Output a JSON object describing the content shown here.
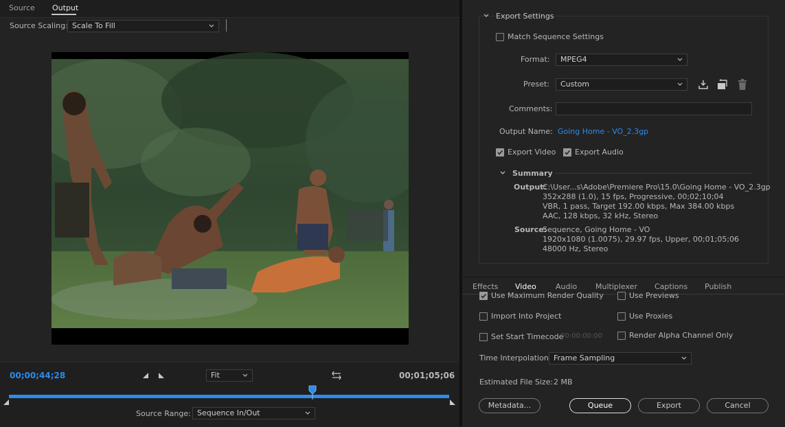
{
  "left": {
    "tabs": [
      {
        "label": "Source"
      },
      {
        "label": "Output"
      }
    ],
    "source_scaling": {
      "label": "Source Scaling:",
      "value": "Scale To Fill"
    },
    "timecode_current": "00;00;44;28",
    "timecode_end": "00;01;05;06",
    "zoom": {
      "value": "Fit"
    },
    "source_range": {
      "label": "Source Range:",
      "value": "Sequence In/Out"
    },
    "playhead_fraction": 0.69
  },
  "export_settings": {
    "header": "Export Settings",
    "match_sequence": {
      "label": "Match Sequence Settings",
      "checked": false
    },
    "format": {
      "label": "Format:",
      "value": "MPEG4"
    },
    "preset": {
      "label": "Preset:",
      "value": "Custom"
    },
    "comments": {
      "label": "Comments:",
      "value": ""
    },
    "output_name": {
      "label": "Output Name:",
      "value": "Going Home - VO_2.3gp"
    },
    "export_video": {
      "label": "Export Video",
      "checked": true
    },
    "export_audio": {
      "label": "Export Audio",
      "checked": true
    },
    "summary": {
      "header": "Summary",
      "output_label": "Output:",
      "output_lines": [
        "C:\\User...s\\Adobe\\Premiere Pro\\15.0\\Going Home - VO_2.3gp",
        "352x288 (1.0), 15 fps, Progressive, 00;02;10;04",
        "VBR, 1 pass, Target 192.00 kbps, Max 384.00 kbps",
        "AAC, 128 kbps, 32 kHz, Stereo"
      ],
      "source_label": "Source:",
      "source_lines": [
        "Sequence, Going Home - VO",
        "1920x1080 (1.0075), 29.97 fps, Upper, 00;01;05;06",
        "48000 Hz, Stereo"
      ]
    }
  },
  "settings_tabs": [
    {
      "label": "Effects"
    },
    {
      "label": "Video"
    },
    {
      "label": "Audio"
    },
    {
      "label": "Multiplexer"
    },
    {
      "label": "Captions"
    },
    {
      "label": "Publish"
    }
  ],
  "options": {
    "max_render_quality": {
      "label": "Use Maximum Render Quality",
      "checked": true
    },
    "use_previews": {
      "label": "Use Previews",
      "checked": false
    },
    "import_project": {
      "label": "Import Into Project",
      "checked": false
    },
    "use_proxies": {
      "label": "Use Proxies",
      "checked": false
    },
    "set_start_tc": {
      "label": "Set Start Timecode",
      "checked": false,
      "value": "00:00:00:00"
    },
    "render_alpha": {
      "label": "Render Alpha Channel Only",
      "checked": false
    },
    "time_interp": {
      "label": "Time Interpolation:",
      "value": "Frame Sampling"
    },
    "file_size": {
      "label": "Estimated File Size:",
      "value": "2 MB"
    }
  },
  "buttons": {
    "metadata": "Metadata...",
    "queue": "Queue",
    "export": "Export",
    "cancel": "Cancel"
  },
  "colors": {
    "accent": "#2d8ceb",
    "panel": "#232323",
    "field": "#1d1d1d"
  }
}
